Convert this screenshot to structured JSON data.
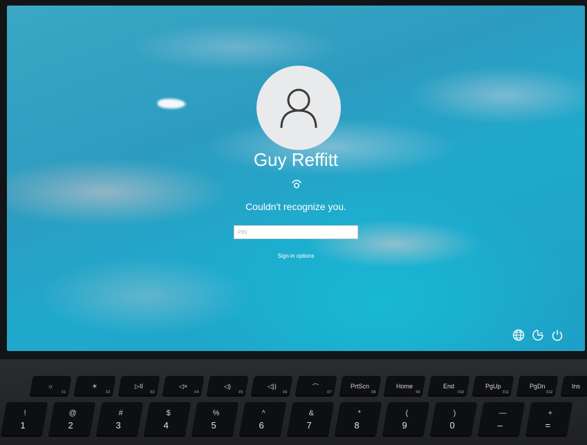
{
  "login": {
    "user_name": "Guy Reffitt",
    "status_message": "Couldn't recognize you.",
    "pin_placeholder": "PIN",
    "pin_value": "",
    "signin_options": "Sign-in options"
  },
  "tray": {
    "icons": [
      "globe-icon",
      "accessibility-icon",
      "power-icon"
    ]
  },
  "keyboard": {
    "function_row": [
      {
        "label": "☼",
        "fn": "F1"
      },
      {
        "label": "☀",
        "fn": "F2"
      },
      {
        "label": "▷II",
        "fn": "F3"
      },
      {
        "label": "◁×",
        "fn": "F4"
      },
      {
        "label": "◁)",
        "fn": "F5"
      },
      {
        "label": "◁))",
        "fn": "F6"
      },
      {
        "label": "⌒",
        "fn": "F7"
      },
      {
        "label": "PrtScn",
        "fn": "F8"
      },
      {
        "label": "Home",
        "fn": "F9"
      },
      {
        "label": "End",
        "fn": "F10"
      },
      {
        "label": "PgUp",
        "fn": "F11"
      },
      {
        "label": "PgDn",
        "fn": "F12"
      },
      {
        "label": "Ins",
        "fn": ""
      }
    ],
    "number_row": [
      {
        "top": "!",
        "bottom": "1"
      },
      {
        "top": "@",
        "bottom": "2"
      },
      {
        "top": "#",
        "bottom": "3"
      },
      {
        "top": "$",
        "bottom": "4"
      },
      {
        "top": "%",
        "bottom": "5"
      },
      {
        "top": "^",
        "bottom": "6"
      },
      {
        "top": "&",
        "bottom": "7"
      },
      {
        "top": "*",
        "bottom": "8"
      },
      {
        "top": "(",
        "bottom": "9"
      },
      {
        "top": ")",
        "bottom": "0"
      },
      {
        "top": "—",
        "bottom": "–"
      },
      {
        "top": "+",
        "bottom": "="
      }
    ]
  }
}
